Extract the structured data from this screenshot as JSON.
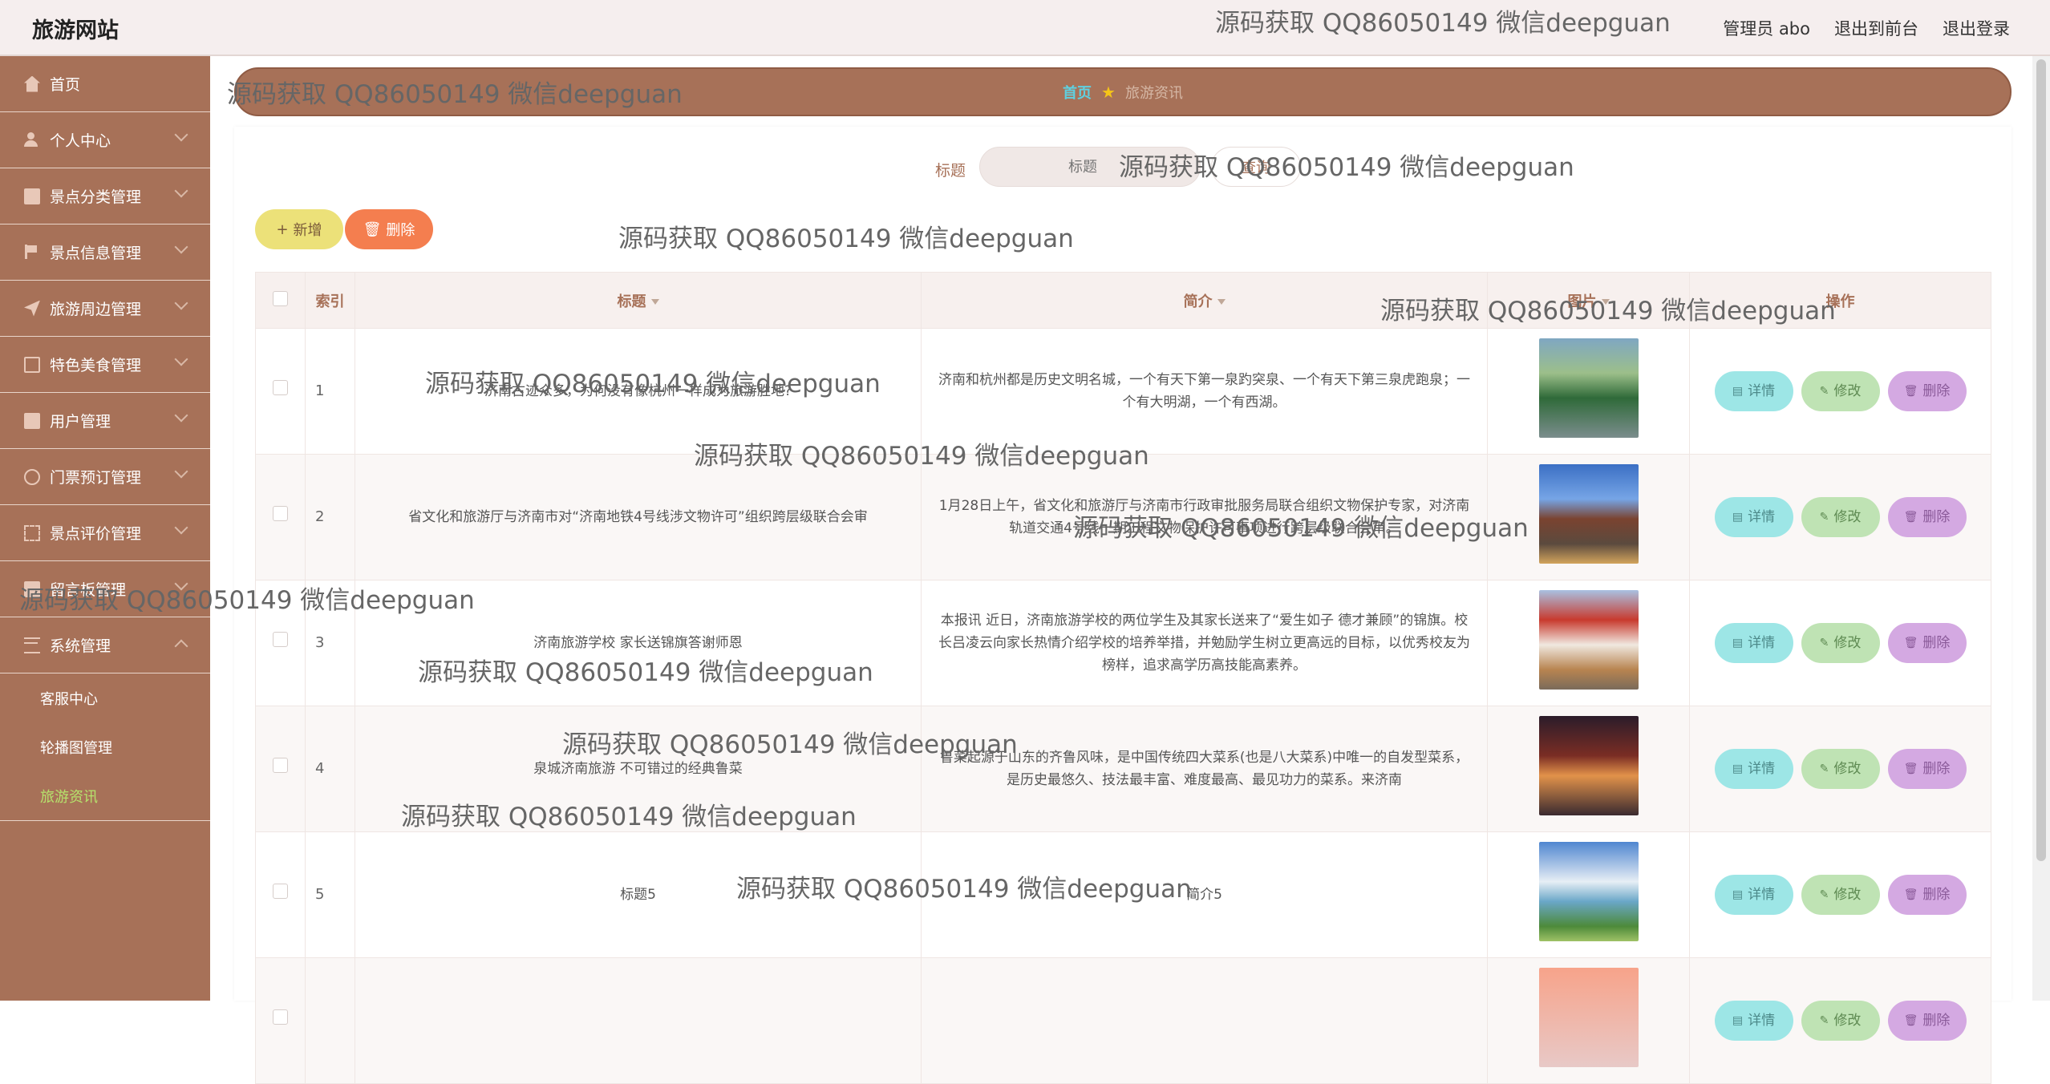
{
  "header": {
    "brand": "旅游网站",
    "user_label": "管理员 abo",
    "to_front": "退出到前台",
    "logout": "退出登录"
  },
  "sidebar": {
    "items": [
      {
        "label": "首页",
        "icon": "home-icon"
      },
      {
        "label": "个人中心",
        "icon": "user-icon"
      },
      {
        "label": "景点分类管理",
        "icon": "box-icon"
      },
      {
        "label": "景点信息管理",
        "icon": "flag-icon"
      },
      {
        "label": "旅游周边管理",
        "icon": "plane-icon"
      },
      {
        "label": "特色美食管理",
        "icon": "copy-icon"
      },
      {
        "label": "用户管理",
        "icon": "doc-icon"
      },
      {
        "label": "门票预订管理",
        "icon": "circle-icon"
      },
      {
        "label": "景点评价管理",
        "icon": "dashed-box-icon"
      },
      {
        "label": "留言板管理",
        "icon": "message-icon"
      },
      {
        "label": "系统管理",
        "icon": "menu-icon"
      }
    ],
    "sub_items": [
      {
        "label": "客服中心"
      },
      {
        "label": "轮播图管理"
      },
      {
        "label": "旅游资讯",
        "active": true
      }
    ]
  },
  "breadcrumb": {
    "home": "首页",
    "current": "旅游资讯"
  },
  "search": {
    "label": "标题",
    "placeholder": "标题",
    "button": "查询"
  },
  "actions": {
    "add": "新增",
    "delete": "删除"
  },
  "table": {
    "headers": {
      "index": "索引",
      "title": "标题",
      "intro": "简介",
      "image": "图片",
      "ops": "操作"
    },
    "op_labels": {
      "detail": "详情",
      "edit": "修改",
      "delete": "删除"
    },
    "rows": [
      {
        "index": "1",
        "title": "济南古迹众多，为何没有像杭州一样成为旅游胜地?",
        "intro": "济南和杭州都是历史文明名城，一个有天下第一泉趵突泉、一个有天下第三泉虎跑泉；一个有大明湖，一个有西湖。"
      },
      {
        "index": "2",
        "title": "省文化和旅游厅与济南市对“济南地铁4号线涉文物许可”组织跨层级联合会审",
        "intro": "1月28日上午，省文化和旅游厅与济南市行政审批服务局联合组织文物保护专家，对济南轨道交通4号线一期工程文物保护许可事项进行跨层级联合会审。"
      },
      {
        "index": "3",
        "title": "济南旅游学校 家长送锦旗答谢师恩",
        "intro": "本报讯 近日，济南旅游学校的两位学生及其家长送来了“爱生如子 德才兼顾”的锦旗。校长吕凌云向家长热情介绍学校的培养举措，并勉励学生树立更高远的目标，以优秀校友为榜样，追求高学历高技能高素养。"
      },
      {
        "index": "4",
        "title": "泉城济南旅游 不可错过的经典鲁菜",
        "intro": "鲁菜起源于山东的齐鲁风味，是中国传统四大菜系(也是八大菜系)中唯一的自发型菜系，是历史最悠久、技法最丰富、难度最高、最见功力的菜系。来济南"
      },
      {
        "index": "5",
        "title": "标题5",
        "intro": "简介5"
      },
      {
        "index": "",
        "title": "",
        "intro": ""
      }
    ]
  },
  "watermark": "源码获取 QQ86050149 微信deepguan",
  "colors": {
    "sidebar_bg": "#a77158",
    "accent_active": "#b6e36c",
    "breadcrumb_home": "#5fd0e0",
    "add_btn": "#ece179",
    "delete_btn": "#f47e4f"
  }
}
